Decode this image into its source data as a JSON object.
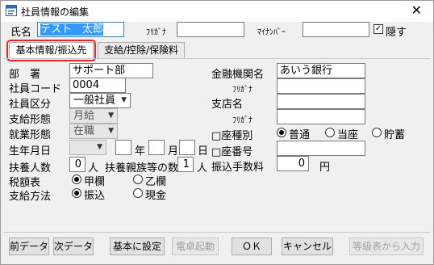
{
  "window": {
    "title": "社員情報の編集",
    "close_glyph": "✕"
  },
  "header": {
    "name_label": "氏名",
    "name_value": "テスト　太郎",
    "furigana_label": "ﾌﾘｶﾞﾅ",
    "furigana_value": "",
    "mynumber_label": "ﾏｲﾅﾝﾊﾞｰ",
    "mynumber_value": "",
    "hide_label": "隠す",
    "hide_checked": true
  },
  "tabs": [
    {
      "label": "基本情報/振込先",
      "active": true
    },
    {
      "label": "支給/控除/保険料",
      "active": false
    }
  ],
  "left": {
    "department_label": "部　署",
    "department_value": "サポート部",
    "employee_code_label": "社員コード",
    "employee_code_value": "0004",
    "employee_type_label": "社員区分",
    "employee_type_value": "一般社員",
    "pay_form_label": "支給形態",
    "pay_form_value": "月給",
    "work_form_label": "就業形態",
    "work_form_value": "在職",
    "birth_label": "生年月日",
    "birth_era_value": "",
    "birth_year_value": "",
    "year_unit": "年",
    "birth_month_value": "",
    "month_unit": "月",
    "birth_day_value": "",
    "day_unit": "日",
    "dependents_label": "扶養人数",
    "dependents_value": "0",
    "person_unit": "人",
    "dependent_relatives_label": "扶養親族等の数",
    "dependent_relatives_value": "1",
    "tax_table_label": "税額表",
    "tax_kou_label": "甲欄",
    "tax_otsu_label": "乙欄",
    "tax_selected": "甲欄",
    "pay_method_label": "支給方法",
    "pay_transfer_label": "振込",
    "pay_cash_label": "現金",
    "pay_method_selected": "振込"
  },
  "right": {
    "bank_label": "金融機関名",
    "bank_value": "あいう銀行",
    "bank_furigana_label": "ﾌﾘｶﾞﾅ",
    "bank_furigana_value": "",
    "branch_label": "支店名",
    "branch_value": "",
    "branch_furigana_label": "ﾌﾘｶﾞﾅ",
    "branch_furigana_value": "",
    "account_type_label": "□座種別",
    "account_normal_label": "普通",
    "account_current_label": "当座",
    "account_savings_label": "貯蓄",
    "account_type_selected": "普通",
    "account_number_label": "□座番号",
    "account_number_value": "",
    "transfer_fee_label": "振込手数料",
    "transfer_fee_value": "0",
    "yen_unit": "円"
  },
  "footer": {
    "prev_label": "前データ",
    "next_label": "次データ",
    "set_default_label": "基本に設定",
    "calculator_label": "電卓起動",
    "ok_label": "ＯＫ",
    "cancel_label": "キャンセル",
    "grade_input_label": "等級表から入力"
  },
  "colors": {
    "tab_highlight": "#e8262a",
    "selection": "#3399ff"
  }
}
